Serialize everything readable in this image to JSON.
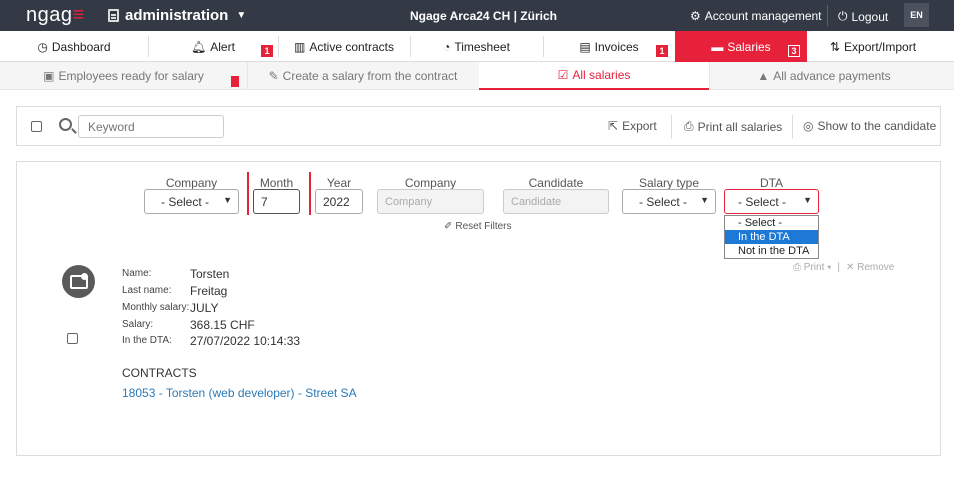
{
  "topbar": {
    "logo_text": "ngag",
    "logo_accent": "≡",
    "app": "administration",
    "center_title": "Ngage Arca24 CH | Zürich",
    "account": "Account management",
    "logout": "Logout",
    "lang": "EN"
  },
  "mainnav": {
    "items": [
      {
        "label": "Dashboard",
        "icon": "dashboard-icon"
      },
      {
        "label": "Alert",
        "icon": "bell-icon",
        "badge": "1"
      },
      {
        "label": "Active contracts",
        "icon": "contracts-icon"
      },
      {
        "label": "Timesheet",
        "icon": "clock-icon"
      },
      {
        "label": "Invoices",
        "icon": "document-icon",
        "badge": "1"
      },
      {
        "label": "Salaries",
        "icon": "salary-icon",
        "badge": "3",
        "active": true
      },
      {
        "label": "Export/Import",
        "icon": "sort-icon"
      }
    ]
  },
  "subnav": {
    "items": [
      {
        "label": "Employees ready for salary"
      },
      {
        "label": "Create a salary from the contract"
      },
      {
        "label": "All salaries",
        "active": true
      },
      {
        "label": "All advance payments"
      }
    ]
  },
  "toolbar": {
    "search_placeholder": "Keyword",
    "export": "Export",
    "print_all": "Print all salaries",
    "show_candidate": "Show to the candidate"
  },
  "filters": {
    "company_label": "Company",
    "company_value": "- Select -",
    "month_label": "Month",
    "month_value": "7",
    "year_label": "Year",
    "year_value": "2022",
    "company2_label": "Company",
    "company2_placeholder": "Company",
    "candidate_label": "Candidate",
    "candidate_placeholder": "Candidate",
    "salary_type_label": "Salary type",
    "salary_type_value": "- Select -",
    "dta_label": "DTA",
    "dta_value": "- Select -",
    "dta_options": [
      "- Select -",
      "In the DTA",
      "Not in the DTA"
    ],
    "dta_highlighted": "In the DTA",
    "reset": "Reset Filters"
  },
  "record": {
    "name_label": "Name:",
    "name": "Torsten",
    "lastname_label": "Last name:",
    "lastname": "Freitag",
    "monthly_label": "Monthly salary:",
    "monthly": "JULY",
    "salary_label": "Salary:",
    "salary": "368.15 CHF",
    "dta_label": "In the DTA:",
    "dta": "27/07/2022 10:14:33",
    "print": "Print",
    "remove": "Remove",
    "contracts_heading": "CONTRACTS",
    "contract_link": "18053 - Torsten (web developer) - Street SA"
  },
  "colors": {
    "accent": "#e8213b",
    "topbar": "#343a45",
    "link": "#2a7ab8"
  }
}
